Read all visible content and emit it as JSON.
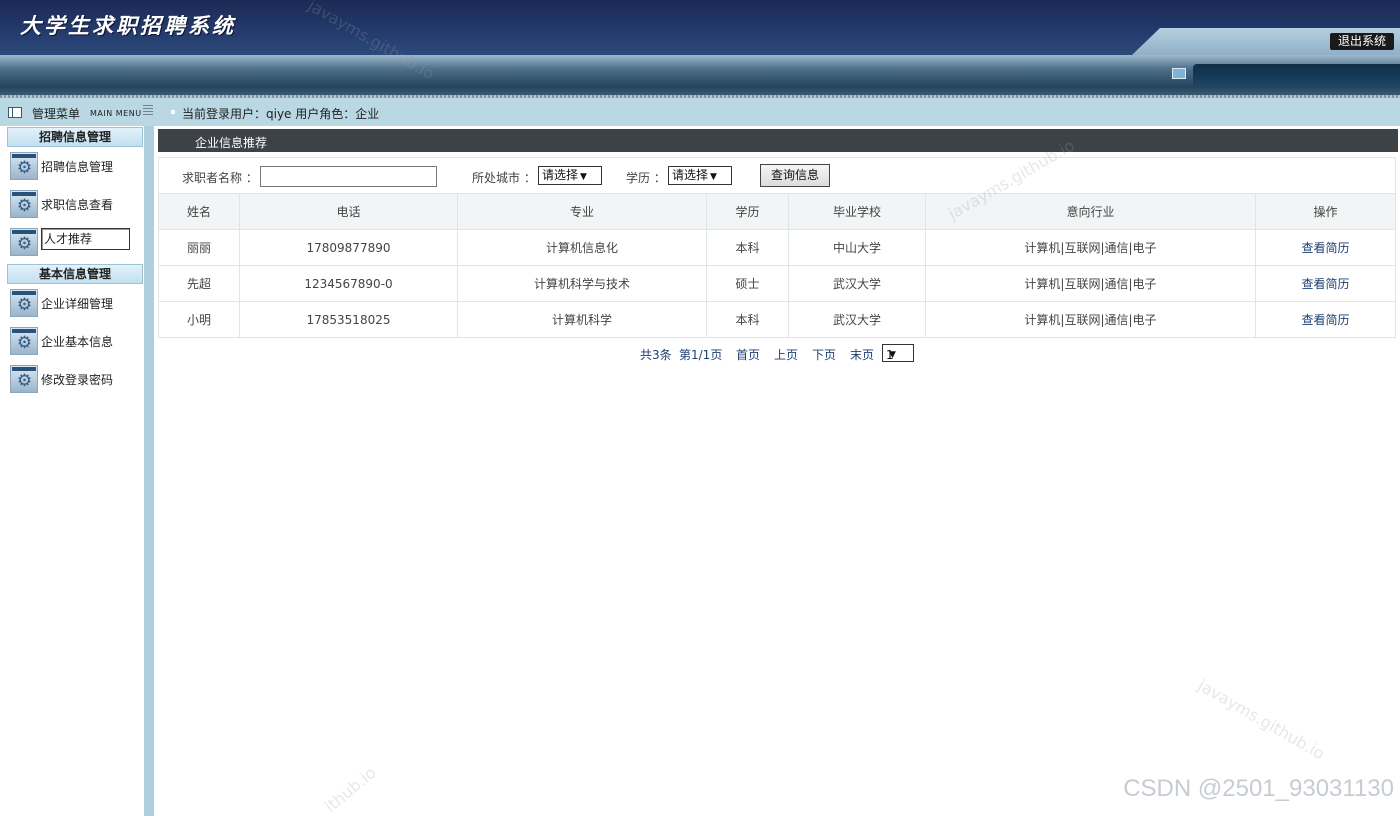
{
  "header": {
    "title": "大学生求职招聘系统",
    "logout_label": "退出系统"
  },
  "subbar": {
    "menu_title": "管理菜单",
    "menu_sub": "MAIN MENU",
    "user_info": "当前登录用户：qiye  用户角色：企业"
  },
  "sidebar": {
    "sections": [
      {
        "title": "招聘信息管理",
        "items": [
          "招聘信息管理",
          "求职信息查看",
          "人才推荐"
        ]
      },
      {
        "title": "基本信息管理",
        "items": [
          "企业详细管理",
          "企业基本信息",
          "修改登录密码"
        ]
      }
    ],
    "active_item": "人才推荐"
  },
  "panel": {
    "title": "企业信息推荐"
  },
  "search": {
    "name_label": "求职者名称 ：",
    "name_value": "",
    "city_label": "所处城市 ：",
    "city_value": "请选择",
    "edu_label": "学历 ：",
    "edu_value": "请选择",
    "submit_label": "查询信息"
  },
  "table": {
    "headers": [
      "姓名",
      "电话",
      "专业",
      "学历",
      "毕业学校",
      "意向行业",
      "操作"
    ],
    "rows": [
      [
        "丽丽",
        "17809877890",
        "计算机信息化",
        "本科",
        "中山大学",
        "计算机|互联网|通信|电子",
        "查看简历"
      ],
      [
        "先超",
        "1234567890-0",
        "计算机科学与技术",
        "硕士",
        "武汉大学",
        "计算机|互联网|通信|电子",
        "查看简历"
      ],
      [
        "小明",
        "17853518025",
        "计算机科学",
        "本科",
        "武汉大学",
        "计算机|互联网|通信|电子",
        "查看简历"
      ]
    ]
  },
  "pager": {
    "total": "共3条",
    "page": "第1/1页",
    "first": "首页",
    "prev": "上页",
    "next": "下页",
    "last": "末页",
    "current": "1"
  },
  "watermarks": [
    "javayms.github.io",
    "javayms.github.io",
    "javayms.github.io",
    "ithub.io"
  ],
  "footer_mark": "CSDN @2501_93031130"
}
